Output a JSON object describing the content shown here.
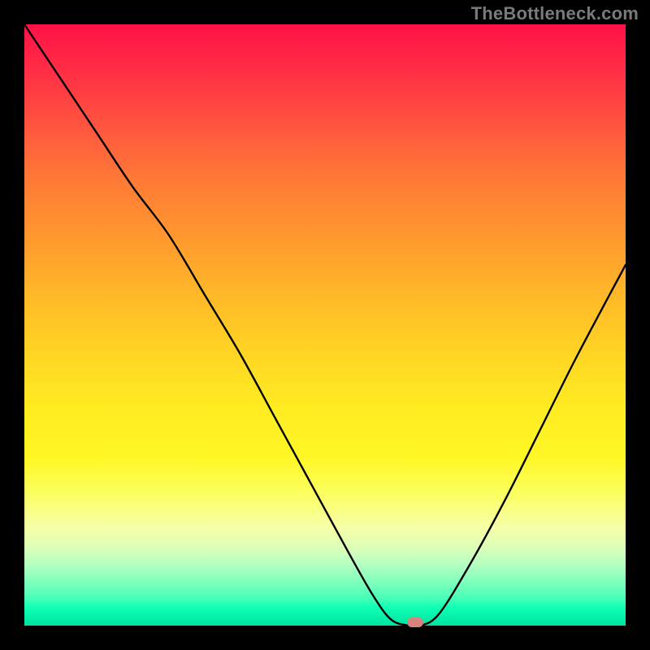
{
  "watermark": "TheBottleneck.com",
  "marker": {
    "color": "#d9837e"
  },
  "chart_data": {
    "type": "line",
    "title": "",
    "xlabel": "",
    "ylabel": "",
    "xlim": [
      0,
      100
    ],
    "ylim": [
      0,
      100
    ],
    "series": [
      {
        "name": "curve",
        "x": [
          0,
          6,
          12,
          18,
          24,
          30,
          36,
          42,
          48,
          54,
          58,
          61,
          64,
          66,
          69,
          74,
          80,
          86,
          92,
          100
        ],
        "y": [
          100,
          91,
          82,
          73,
          65,
          55,
          45,
          34,
          23,
          12,
          5,
          1,
          0,
          0,
          2,
          10,
          21,
          33,
          45,
          60
        ]
      }
    ],
    "optimum_x": 65
  }
}
